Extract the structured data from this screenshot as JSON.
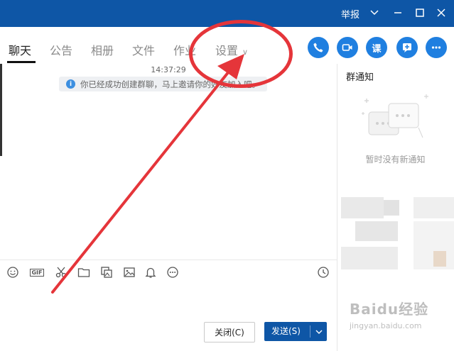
{
  "titlebar": {
    "report": "举报",
    "icons": [
      "chevron-down-icon",
      "minimize-icon",
      "maximize-icon",
      "close-icon"
    ]
  },
  "tabs": [
    {
      "label": "聊天",
      "active": true
    },
    {
      "label": "公告"
    },
    {
      "label": "相册"
    },
    {
      "label": "文件"
    },
    {
      "label": "作业"
    },
    {
      "label": "设置",
      "caret": "∨"
    }
  ],
  "action_buttons": [
    "phone-icon",
    "video-icon",
    "class-icon",
    "add-app-icon",
    "more-icon"
  ],
  "class_button_text": "课",
  "chat": {
    "timestamp": "14:37:29",
    "system_message": "你已经成功创建群聊，马上邀请你的好友加入吧。"
  },
  "notice": {
    "title": "群通知",
    "empty_text": "暂时没有新通知"
  },
  "toolbar_icons": [
    "emoji-icon",
    "gif-icon",
    "scissors-icon",
    "folder-icon",
    "image-gallery-icon",
    "picture-icon",
    "bell-icon",
    "more-circle-icon",
    "history-clock-icon"
  ],
  "gif_label": "GIF",
  "buttons": {
    "close": "关闭(C)",
    "send": "发送(S)",
    "send_dropdown": "∨"
  },
  "watermark": {
    "text": "Baidu经验",
    "url": "jingyan.baidu.com"
  },
  "colors": {
    "titlebar": "#0e56a6",
    "accent": "#1f7fe0",
    "annotation": "#e5353a"
  }
}
